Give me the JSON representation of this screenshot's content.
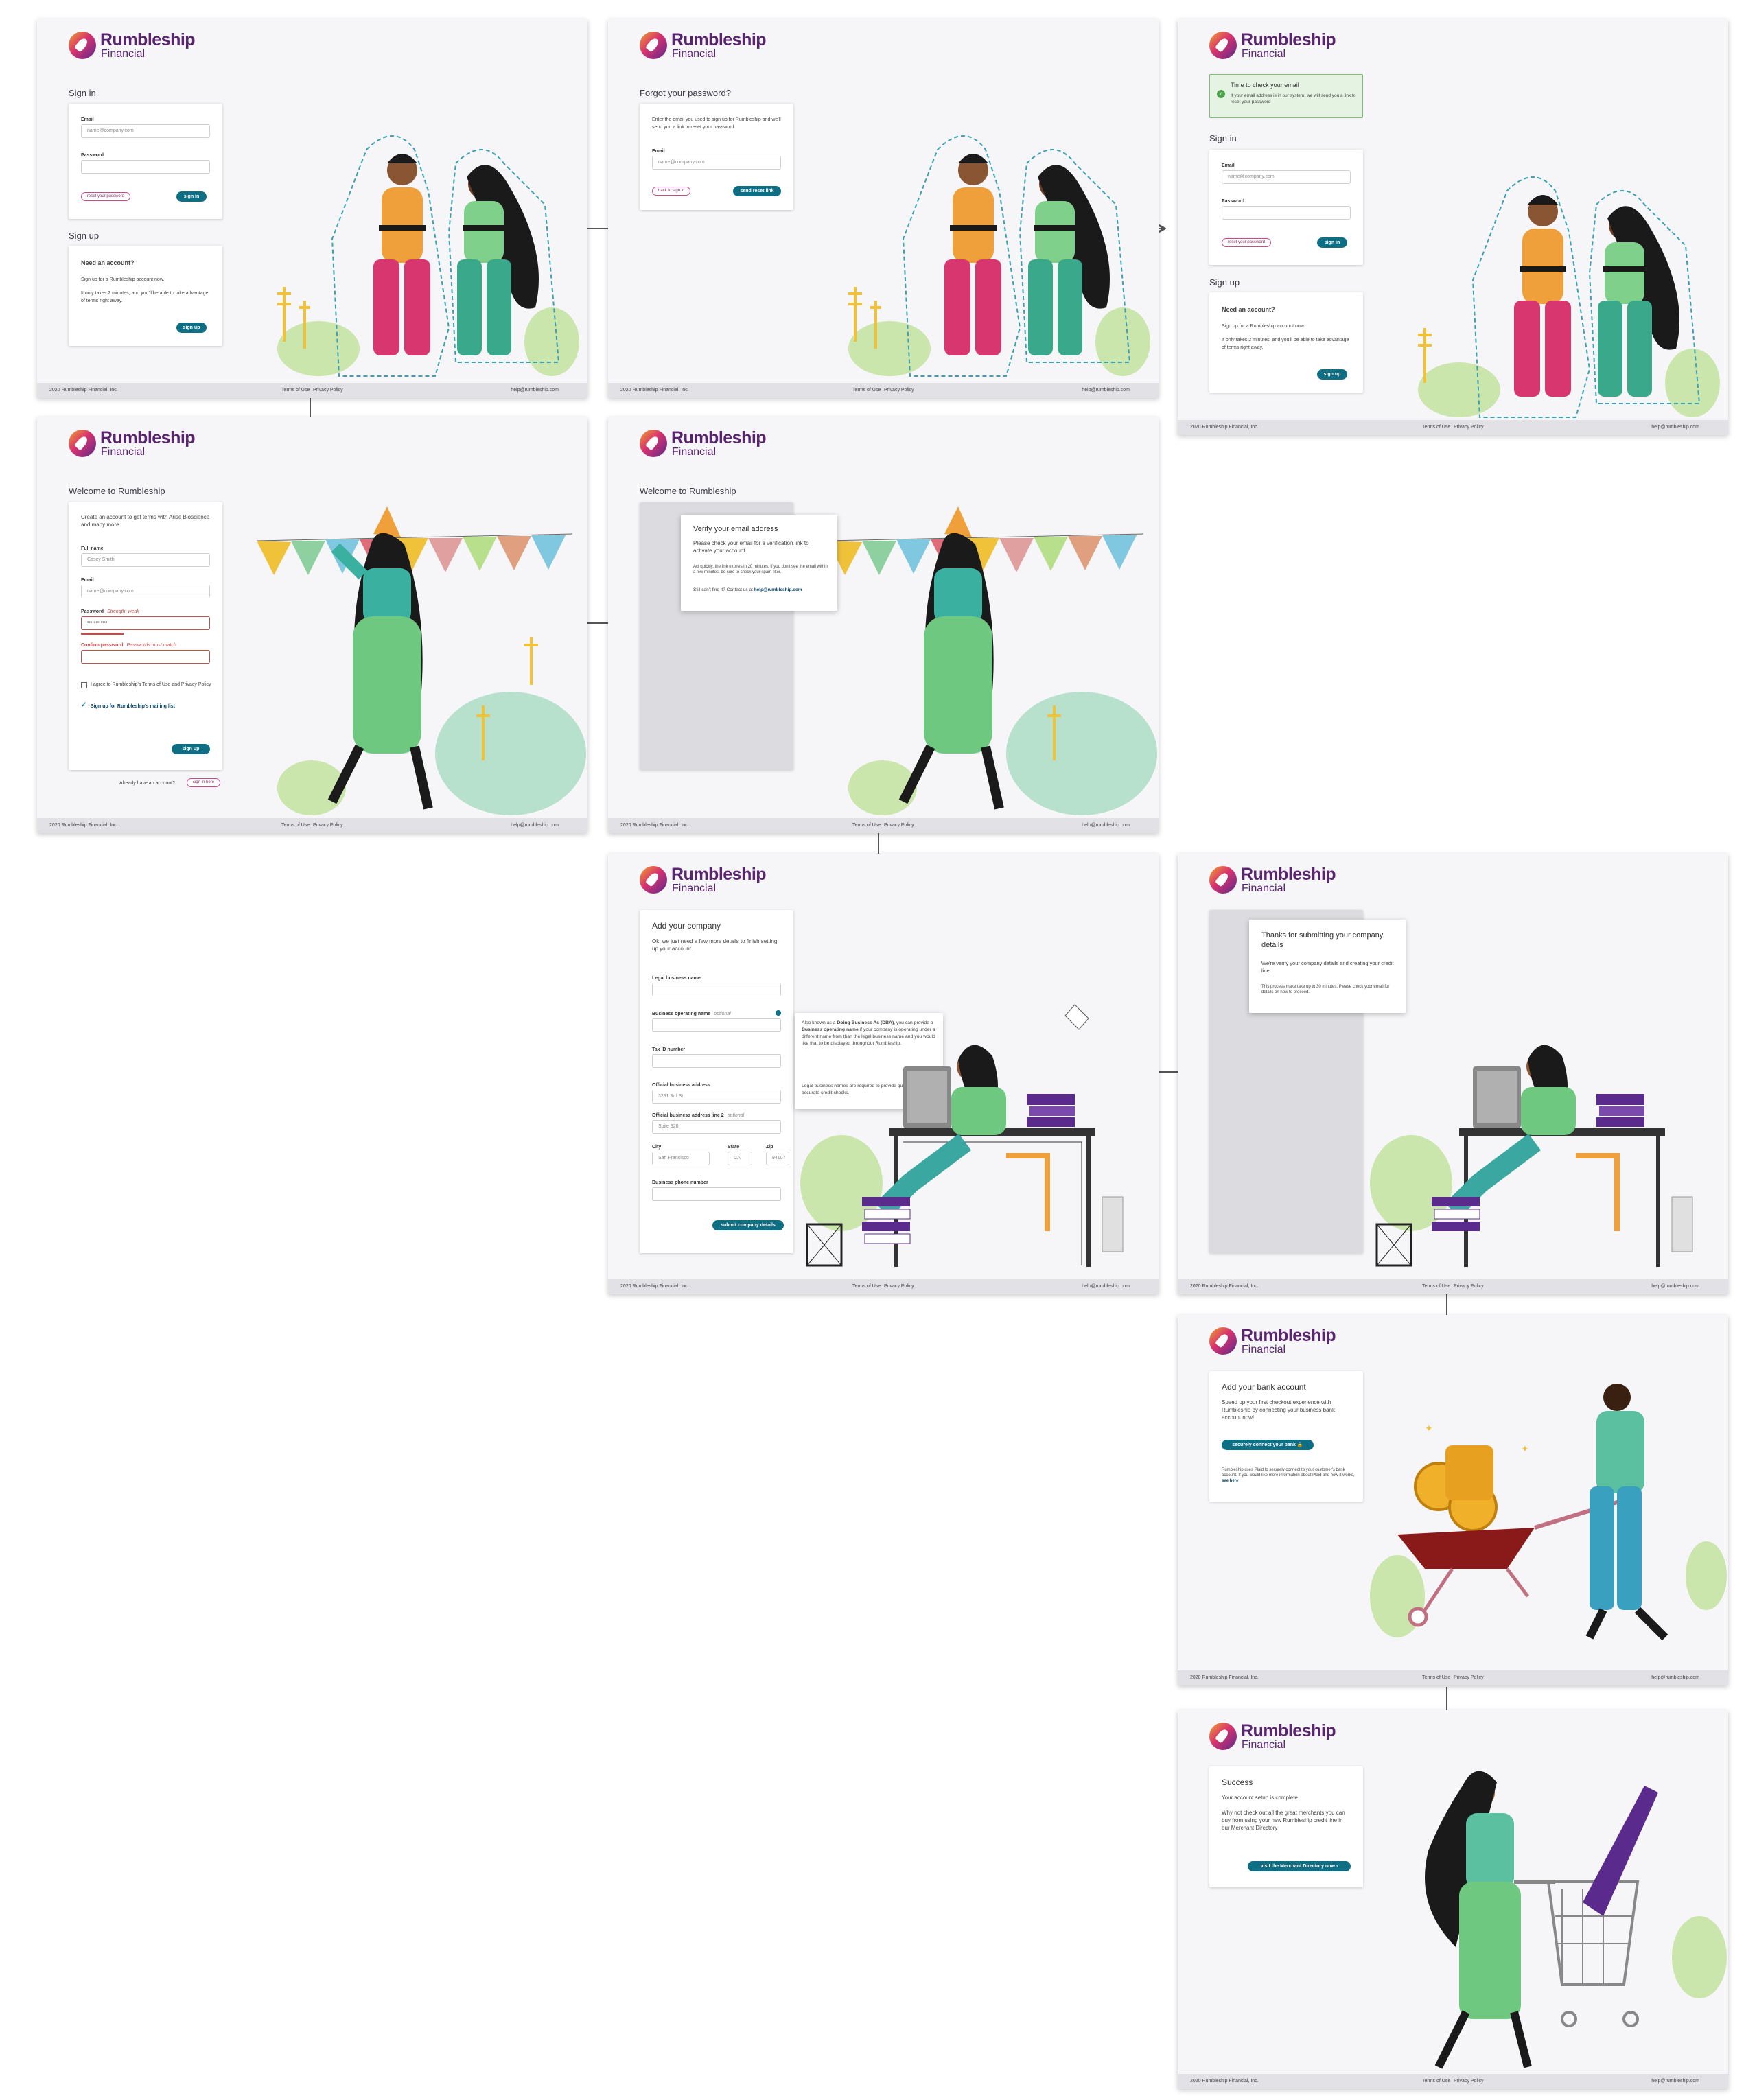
{
  "brand": {
    "name": "Rumbleship",
    "sub": "Financial"
  },
  "footer": {
    "copyright": "2020 Rumbleship Financial, Inc.",
    "terms": "Terms of Use",
    "privacy": "Privacy Policy",
    "email": "help@rumbleship.com"
  },
  "signin": {
    "heading": "Sign in",
    "email_label": "Email",
    "email_placeholder": "name@company.com",
    "password_label": "Password",
    "reset_link": "reset your password",
    "signin_button": "sign in",
    "signup_heading": "Sign up",
    "need_account": "Need an account?",
    "signup_text1": "Sign up for a Rumbleship account now.",
    "signup_text2": "It only takes 2 minutes, and you'll be able to take advantage of terms right away.",
    "signup_button": "sign up"
  },
  "forgot": {
    "heading": "Forgot your password?",
    "text": "Enter the email you used to sign up for Rumbleship and we'll send you a link to reset your password",
    "email_label": "Email",
    "email_placeholder": "name@company.com",
    "back_link": "back to sign in",
    "send_button": "send reset link"
  },
  "check_email": {
    "title": "Time to check your email",
    "text": "If your email address is in our system, we will send you a link to reset your password"
  },
  "welcome": {
    "heading": "Welcome to Rumbleship",
    "intro": "Create an account to get terms with Arise Bioscience and many more",
    "fullname_label": "Full name",
    "fullname_value": "Casey Smith",
    "email_label": "Email",
    "email_placeholder": "name@company.com",
    "password_label": "Password",
    "password_hint": "Strength: weak",
    "password_value": "••••••••••••",
    "confirm_label": "Confirm password",
    "confirm_hint": "Passwords must match",
    "agree_text": "I agree to Rumbleship's Terms of Use and Privacy Policy",
    "mailing_text": "Sign up for Rumbleship's mailing list",
    "signup_button": "sign up",
    "already": "Already have an account?",
    "signin_here": "sign in here"
  },
  "verify": {
    "title": "Verify your email address",
    "text": "Please check your email for a verification link to activate your account.",
    "fine": "Act quickly, the link expires in 20 minutes. If you don't see the email within a few minutes, be sure to check your spam filter.",
    "help": "Still can't find it? Contact us at",
    "help_email": "help@rumbleship.com"
  },
  "company": {
    "heading": "Add your company",
    "intro": "Ok, we just need a few more details to finish setting up your account.",
    "legal_label": "Legal business name",
    "dba_label": "Business operating name",
    "optional": "optional",
    "tax_label": "Tax ID number",
    "addr_label": "Official business address",
    "addr_value": "3231 3rd St",
    "addr2_label": "Official business address line 2",
    "addr2_value": "Suite 320",
    "city_label": "City",
    "city_value": "San Francisco",
    "state_label": "State",
    "state_value": "CA",
    "zip_label": "Zip",
    "zip_value": "94107",
    "phone_label": "Business phone number",
    "submit_button": "submit company details",
    "tip_1": "Also known as a",
    "tip_bold1": "Doing Business As (DBA)",
    "tip_2": ", you can provide a",
    "tip_bold2": "Business operating name",
    "tip_3": "if your company is operating under a different name from than the legal business name and you would like that to be displayed throughout Rumbleship.",
    "tip_4": "Legal business names are required to provide quick and accurate credit checks."
  },
  "thanks": {
    "title": "Thanks for submitting your company details",
    "text": "We're verify your company details and creating your credit line",
    "fine": "This process make take up to 30 minutes. Please check your email for details on how to proceed."
  },
  "bank": {
    "heading": "Add your bank account",
    "text": "Speed up your first checkout experience with Rumbleship by connecting your business bank account now!",
    "button": "securely connect your bank",
    "fine": "Rumbleship uses Plaid to securely connect to your customer's bank account. If you would like more information about Plaid and how it works,",
    "fine_link": "see here"
  },
  "success": {
    "heading": "Success",
    "line1": "Your account setup is complete.",
    "line2": "Why not check out all the great merchants you can buy from using your new Rumbleship credit line in our Merchant Directory",
    "button": "visit the Merchant Directory now"
  },
  "colors": {
    "brand": "#5a2570",
    "accent": "#0e6e84",
    "error": "#c0504d",
    "success": "#7cbf74"
  },
  "icons": [
    "rocket-logo-icon",
    "lock-icon",
    "arrow-right-icon",
    "check-circle-icon",
    "info-icon",
    "mail-icon",
    "user-icon"
  ]
}
